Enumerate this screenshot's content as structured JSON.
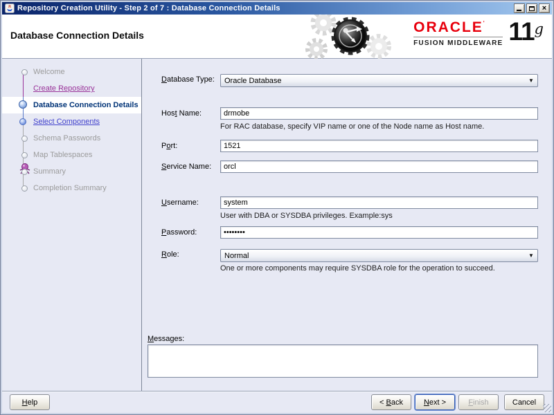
{
  "window": {
    "title": "Repository Creation Utility - Step 2 of 7 : Database Connection Details",
    "icons": {
      "app": "java-coffee-cup",
      "minimize": "minimize-glyph",
      "maximize": "maximize-glyph",
      "close": "close-glyph"
    }
  },
  "header": {
    "title": "Database Connection Details",
    "brand": {
      "oracle": "ORACLE",
      "mark": "'",
      "line2": "FUSION MIDDLEWARE",
      "version": "11",
      "edition": "g"
    },
    "graphic": "gears-logo"
  },
  "sidebar": {
    "steps": [
      {
        "label": "Welcome",
        "state": "pending"
      },
      {
        "label": "Create Repository",
        "state": "visited"
      },
      {
        "label": "Database Connection Details",
        "state": "current"
      },
      {
        "label": "Select Components",
        "state": "linked"
      },
      {
        "label": "Schema Passwords",
        "state": "pending"
      },
      {
        "label": "Map Tablespaces",
        "state": "pending"
      },
      {
        "label": "Summary",
        "state": "pending"
      },
      {
        "label": "Completion Summary",
        "state": "pending"
      }
    ]
  },
  "form": {
    "database_type": {
      "label": {
        "pre": "",
        "key": "D",
        "post": "atabase Type:"
      },
      "value": "Oracle Database"
    },
    "host_name": {
      "label": {
        "pre": "Hos",
        "key": "t",
        "post": " Name:"
      },
      "value": "drmobe",
      "hint": "For RAC database, specify VIP name or one of the Node name as Host name."
    },
    "port": {
      "label": {
        "pre": "P",
        "key": "o",
        "post": "rt:"
      },
      "value": "1521"
    },
    "service_name": {
      "label": {
        "pre": "",
        "key": "S",
        "post": "ervice Name:"
      },
      "value": "orcl"
    },
    "username": {
      "label": {
        "pre": "",
        "key": "U",
        "post": "sername:"
      },
      "value": "system",
      "hint": "User with DBA or SYSDBA privileges. Example:sys"
    },
    "password": {
      "label": {
        "pre": "",
        "key": "P",
        "post": "assword:"
      },
      "value": "••••••••"
    },
    "role": {
      "label": {
        "pre": "",
        "key": "R",
        "post": "ole:"
      },
      "value": "Normal",
      "hint": "One or more components may require SYSDBA role for the operation to succeed."
    },
    "messages": {
      "label": {
        "pre": "",
        "key": "M",
        "post": "essages:"
      },
      "value": ""
    }
  },
  "buttons": {
    "help": {
      "pre": "",
      "key": "H",
      "post": "elp"
    },
    "back": {
      "pre": "< ",
      "key": "B",
      "post": "ack"
    },
    "next": {
      "pre": "",
      "key": "N",
      "post": "ext >"
    },
    "finish": {
      "pre": "",
      "key": "F",
      "post": "inish",
      "disabled": "true"
    },
    "cancel": {
      "pre": "",
      "key": "",
      "post": "Cancel"
    }
  },
  "colors": {
    "titlebar_start": "#0a246a",
    "titlebar_end": "#a6caf0",
    "oracle_red": "#e8000d",
    "content_bg": "#e7e9f4",
    "link_visited": "#993399",
    "link_next": "#4040cc",
    "step_current": "#003377"
  }
}
